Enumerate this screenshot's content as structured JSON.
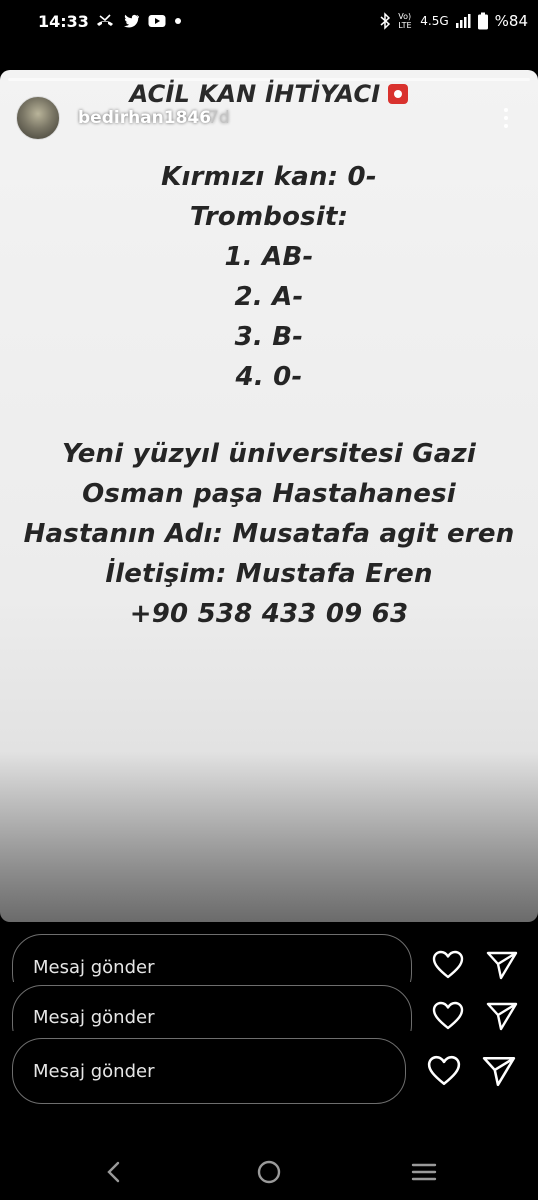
{
  "status_bar": {
    "time": "14:33",
    "network": "4.5G",
    "volte": "Vo) LTE",
    "battery": "%84"
  },
  "story": {
    "username": "bedirhan1846",
    "age": "7d",
    "headline": "ACİL KAN İHTİYACI",
    "lines": [
      "Kırmızı kan: 0-",
      "Trombosit:",
      "1. AB-",
      "2. A-",
      "3. B-",
      "4. 0-",
      "Yeni yüzyıl üniversitesi Gazi",
      "Osman paşa Hastahanesi",
      "Hastanın Adı: Musatafa agit eren",
      "İletişim: Mustafa Eren",
      "+90 538 433 09 63"
    ]
  },
  "reply": {
    "placeholders": [
      "Mesaj gönder",
      "Mesaj gönder",
      "Mesaj gönder"
    ]
  },
  "icons": {
    "status_left": [
      "missed-call-icon",
      "twitter-icon",
      "youtube-icon",
      "dot-icon"
    ],
    "status_right": [
      "bluetooth-icon",
      "signal-icon",
      "battery-icon"
    ],
    "nav": [
      "back-icon",
      "home-icon",
      "recents-icon"
    ]
  },
  "colors": {
    "background": "#000000",
    "story_background": "#efefef",
    "story_text": "#252525",
    "headline_icon": "#d9322e"
  }
}
